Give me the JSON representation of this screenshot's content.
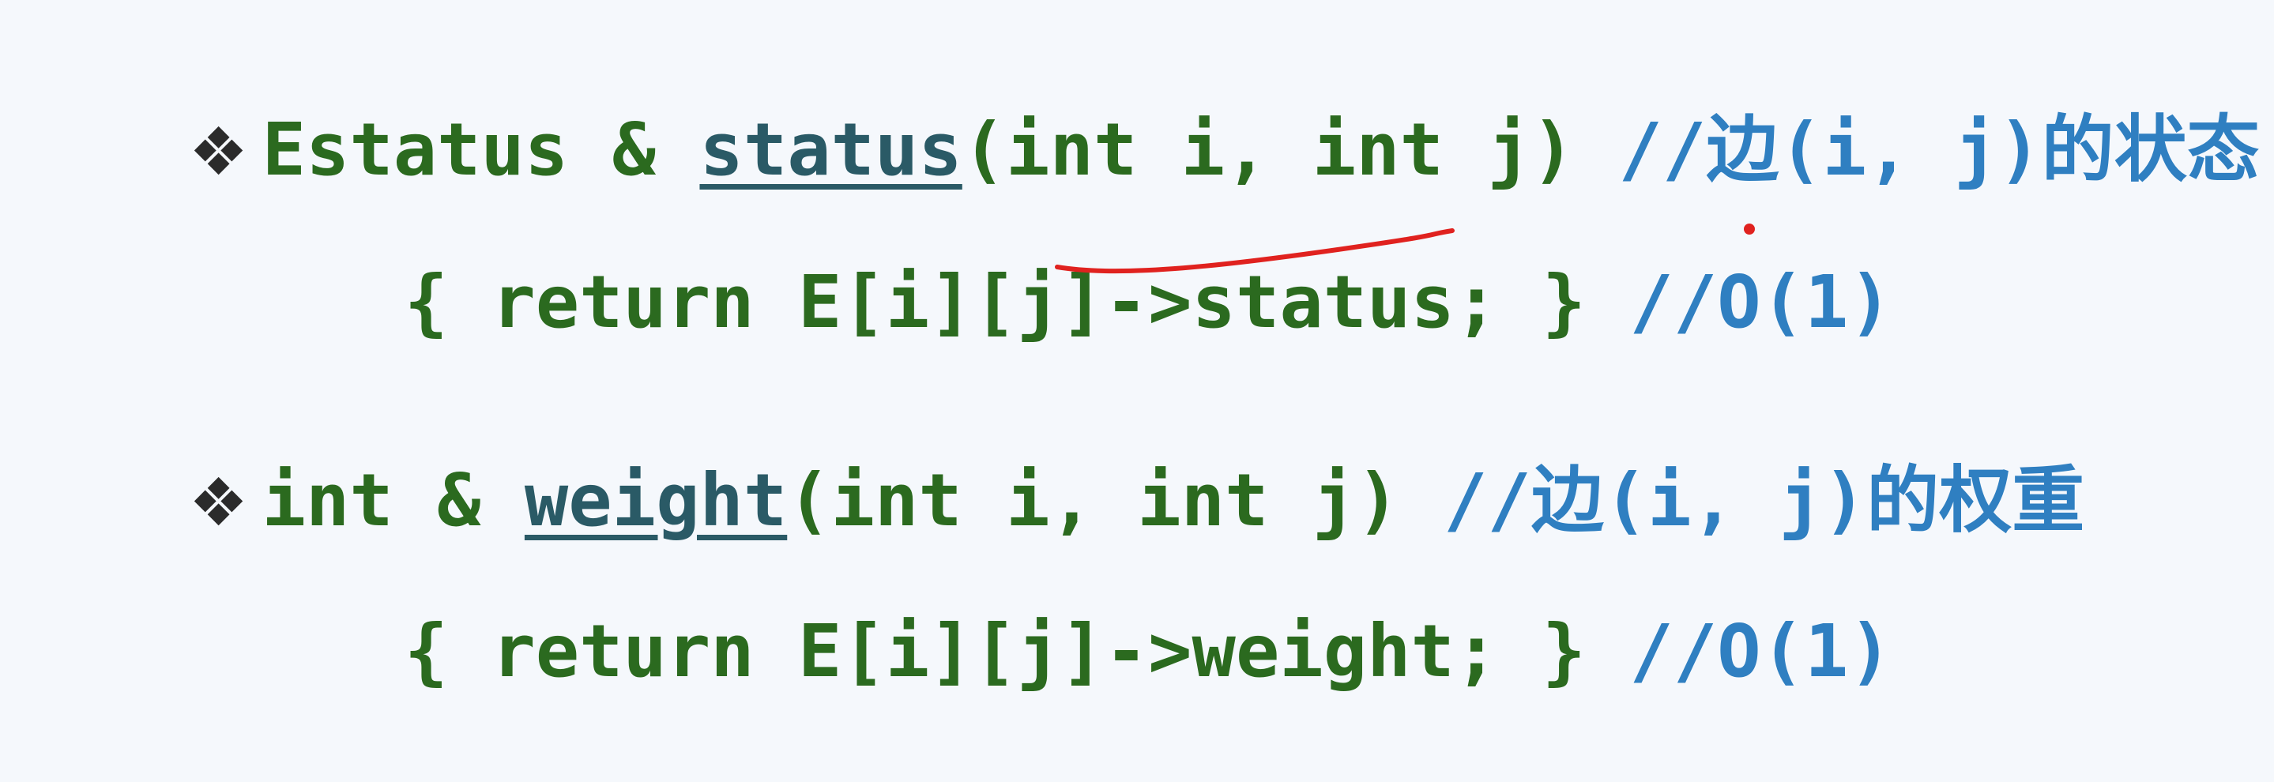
{
  "lines": [
    {
      "bullet": "❖",
      "type": "Estatus & ",
      "fn": "status",
      "params": "(int i, int j) ",
      "comment": "//边(i, j)的状态"
    },
    {
      "code": "{ return E[i][j]->status; } ",
      "comment": "//O(1)"
    },
    {
      "bullet": "❖",
      "type": "int & ",
      "fn": "weight",
      "params": "(int i, int j) ",
      "comment": "//边(i, j)的权重"
    },
    {
      "code": "{ return E[i][j]->weight; } ",
      "comment": "//O(1)"
    }
  ],
  "colors": {
    "background": "#f5f8fc",
    "code": "#2b6a1f",
    "function_name": "#2a5a66",
    "comment": "#2f7fc1",
    "bullet": "#2b2b2b",
    "annotation_ink": "#e0221f"
  },
  "icons": {
    "bullet": "diamond-bullet-icon"
  }
}
